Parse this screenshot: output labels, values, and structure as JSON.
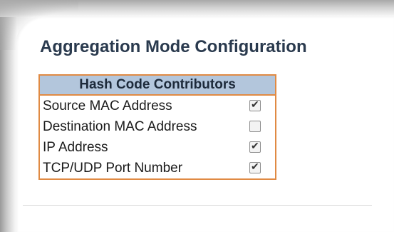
{
  "page": {
    "title": "Aggregation Mode Configuration"
  },
  "table": {
    "header": "Hash Code Contributors",
    "rows": [
      {
        "label": "Source MAC Address",
        "checked": true
      },
      {
        "label": "Destination MAC Address",
        "checked": false
      },
      {
        "label": "IP Address",
        "checked": true
      },
      {
        "label": "TCP/UDP Port Number",
        "checked": true
      }
    ]
  },
  "colors": {
    "title": "#2a3a4e",
    "table_border": "#e08a43",
    "header_bg": "#b3c6dc"
  }
}
